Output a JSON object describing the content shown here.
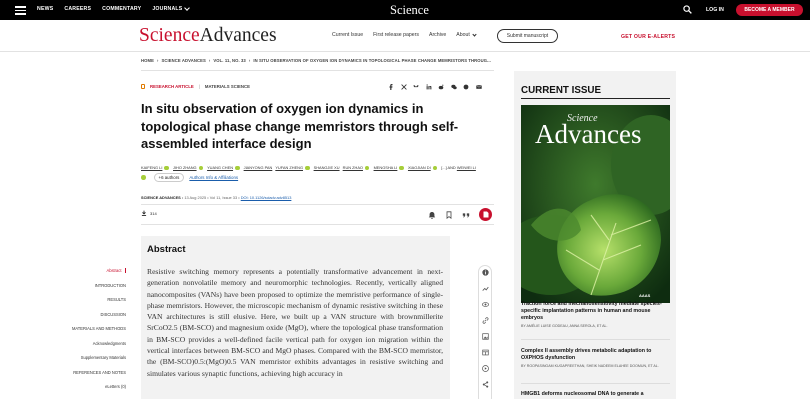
{
  "topbar": {
    "nav": [
      {
        "label": "NEWS"
      },
      {
        "label": "CAREERS"
      },
      {
        "label": "COMMENTARY"
      },
      {
        "label": "JOURNALS"
      }
    ],
    "logo": "Science",
    "login": "LOG IN",
    "member_button": "BECOME A MEMBER"
  },
  "header": {
    "logo_science": "Science",
    "logo_advances": "Advances",
    "nav": [
      {
        "label": "Current Issue"
      },
      {
        "label": "First release papers"
      },
      {
        "label": "Archive"
      },
      {
        "label": "About"
      }
    ],
    "submit_button": "Submit manuscript",
    "alerts_link": "GET OUR E-ALERTS"
  },
  "breadcrumb": [
    "HOME",
    "SCIENCE ADVANCES",
    "VOL. 11, NO. 33",
    "IN SITU OBSERVATION OF OXYGEN ION DYNAMICS IN TOPOLOGICAL PHASE CHANGE MEMRISTORS THROUG..."
  ],
  "article": {
    "type": "RESEARCH ARTICLE",
    "category": "MATERIALS SCIENCE",
    "title": "In situ observation of oxygen ion dynamics in topological phase change memristors through self-assembled interface design",
    "authors": [
      "KAIFENG LI",
      "JIHO ZHANG",
      "YUANG CHEN",
      "JIANYONG PAN",
      "YUFAN ZHENG",
      "SHANGJIE XU",
      "RUN ZHAO",
      "MENGSHA LI",
      "XIAOJIAN DI",
      "[...]",
      "AND",
      "WEIWEI LI"
    ],
    "more_authors": "+6 authors",
    "affiliations_link": "Authors Info & Affiliations",
    "journal": "SCIENCE ADVANCES",
    "date": "13 Aug 2025",
    "volume": "Vol 11, Issue 33",
    "doi": "DOI: 10.1126/sciadv.adv8513",
    "download_count": "314"
  },
  "toc": [
    {
      "label": "Abstract",
      "active": true
    },
    {
      "label": "INTRODUCTION"
    },
    {
      "label": "RESULTS"
    },
    {
      "label": "DISCUSSION"
    },
    {
      "label": "MATERIALS AND METHODS"
    },
    {
      "label": "Acknowledgments"
    },
    {
      "label": "Supplementary Materials"
    },
    {
      "label": "REFERENCES AND NOTES"
    },
    {
      "label": "eLetters (0)"
    }
  ],
  "abstract": {
    "heading": "Abstract",
    "text": "Resistive switching memory represents a potentially transformative advancement in next-generation nonvolatile memory and neuromorphic technologies. Recently, vertically aligned nanocomposites (VANs) have been proposed to optimize the memristive performance of single-phase memristors. However, the microscopic mechanism of dynamic resistive switching in these VAN architectures is still elusive. Here, we built up a VAN structure with brownmillerite SrCoO2.5 (BM-SCO) and magnesium oxide (MgO), where the topological phase transformation in BM-SCO provides a well-defined facile vertical path for oxygen ion migration within the vertical interfaces between BM-SCO and MgO phases. Compared with the BM-SCO memristor, the (BM-SCO)0.5:(MgO)0.5 VAN memristor exhibits advantages in resistive switching and simulates various synaptic functions, achieving high accuracy in"
  },
  "rightcol": {
    "heading": "CURRENT ISSUE",
    "cover_science": "Science",
    "cover_advances": "Advances",
    "cover_aaas": "AAAS",
    "news": [
      {
        "title": "Traction force and mechanosensitivity mediate species-specific implantation patterns in human and mouse embryos",
        "byline": "BY AMÉLIE LUISE GODEAU, ANNA SEROLA, ET AL."
      },
      {
        "title": "Complex II assembly drives metabolic adaptation to OXPHOS dysfunction",
        "byline": "BY ROOPASINGAM KUGAPREETHAN, SHEIK NADEEM ELAHEE DOOMUN, ET AL."
      },
      {
        "title": "HMGB1 deforms nucleosomal DNA to generate a",
        "byline": ""
      }
    ]
  },
  "colors": {
    "brand_red": "#c8102e",
    "orcid_green": "#a6ce39",
    "link_blue": "#1a5dab"
  }
}
